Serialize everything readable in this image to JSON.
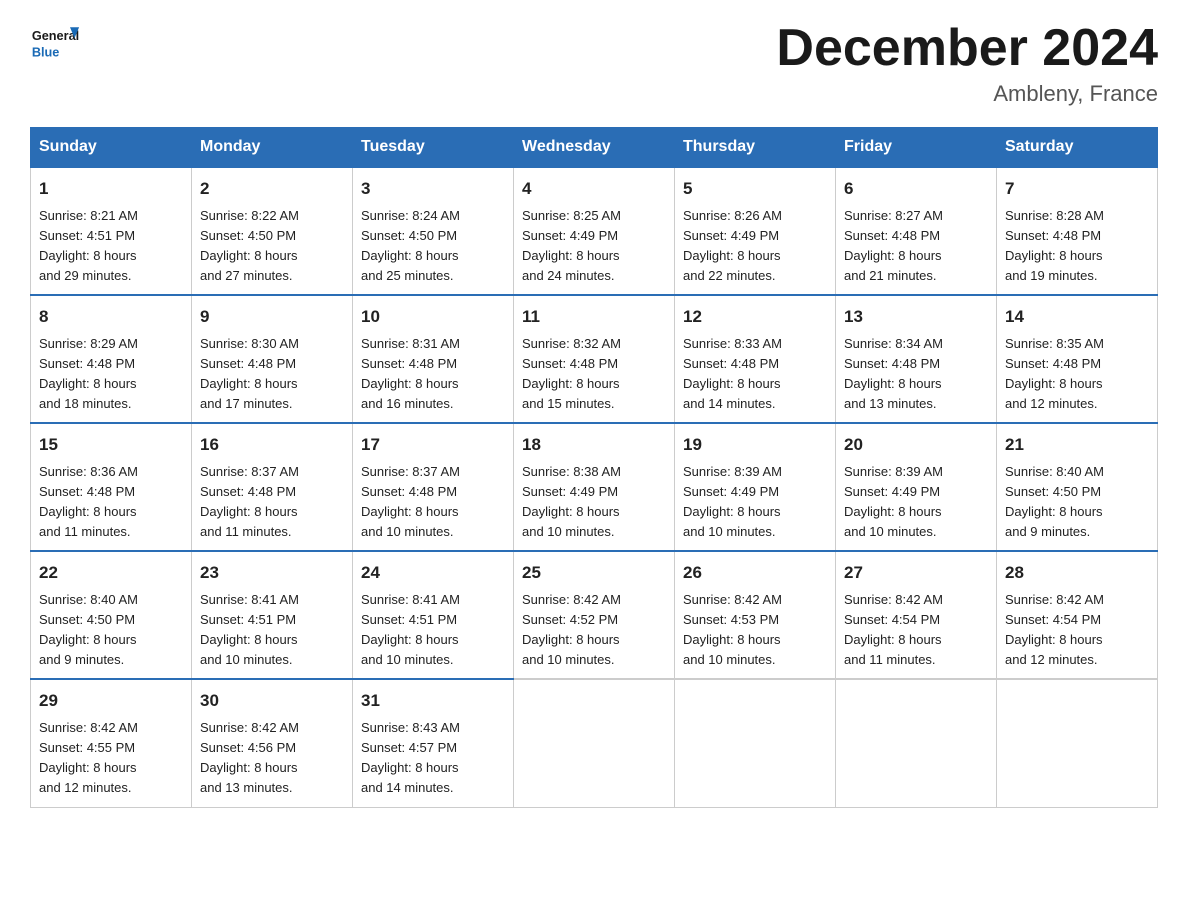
{
  "header": {
    "logo_general": "General",
    "logo_blue": "Blue",
    "month_title": "December 2024",
    "location": "Ambleny, France"
  },
  "days_of_week": [
    "Sunday",
    "Monday",
    "Tuesday",
    "Wednesday",
    "Thursday",
    "Friday",
    "Saturday"
  ],
  "weeks": [
    [
      {
        "day": "1",
        "sunrise": "8:21 AM",
        "sunset": "4:51 PM",
        "daylight": "8 hours and 29 minutes."
      },
      {
        "day": "2",
        "sunrise": "8:22 AM",
        "sunset": "4:50 PM",
        "daylight": "8 hours and 27 minutes."
      },
      {
        "day": "3",
        "sunrise": "8:24 AM",
        "sunset": "4:50 PM",
        "daylight": "8 hours and 25 minutes."
      },
      {
        "day": "4",
        "sunrise": "8:25 AM",
        "sunset": "4:49 PM",
        "daylight": "8 hours and 24 minutes."
      },
      {
        "day": "5",
        "sunrise": "8:26 AM",
        "sunset": "4:49 PM",
        "daylight": "8 hours and 22 minutes."
      },
      {
        "day": "6",
        "sunrise": "8:27 AM",
        "sunset": "4:48 PM",
        "daylight": "8 hours and 21 minutes."
      },
      {
        "day": "7",
        "sunrise": "8:28 AM",
        "sunset": "4:48 PM",
        "daylight": "8 hours and 19 minutes."
      }
    ],
    [
      {
        "day": "8",
        "sunrise": "8:29 AM",
        "sunset": "4:48 PM",
        "daylight": "8 hours and 18 minutes."
      },
      {
        "day": "9",
        "sunrise": "8:30 AM",
        "sunset": "4:48 PM",
        "daylight": "8 hours and 17 minutes."
      },
      {
        "day": "10",
        "sunrise": "8:31 AM",
        "sunset": "4:48 PM",
        "daylight": "8 hours and 16 minutes."
      },
      {
        "day": "11",
        "sunrise": "8:32 AM",
        "sunset": "4:48 PM",
        "daylight": "8 hours and 15 minutes."
      },
      {
        "day": "12",
        "sunrise": "8:33 AM",
        "sunset": "4:48 PM",
        "daylight": "8 hours and 14 minutes."
      },
      {
        "day": "13",
        "sunrise": "8:34 AM",
        "sunset": "4:48 PM",
        "daylight": "8 hours and 13 minutes."
      },
      {
        "day": "14",
        "sunrise": "8:35 AM",
        "sunset": "4:48 PM",
        "daylight": "8 hours and 12 minutes."
      }
    ],
    [
      {
        "day": "15",
        "sunrise": "8:36 AM",
        "sunset": "4:48 PM",
        "daylight": "8 hours and 11 minutes."
      },
      {
        "day": "16",
        "sunrise": "8:37 AM",
        "sunset": "4:48 PM",
        "daylight": "8 hours and 11 minutes."
      },
      {
        "day": "17",
        "sunrise": "8:37 AM",
        "sunset": "4:48 PM",
        "daylight": "8 hours and 10 minutes."
      },
      {
        "day": "18",
        "sunrise": "8:38 AM",
        "sunset": "4:49 PM",
        "daylight": "8 hours and 10 minutes."
      },
      {
        "day": "19",
        "sunrise": "8:39 AM",
        "sunset": "4:49 PM",
        "daylight": "8 hours and 10 minutes."
      },
      {
        "day": "20",
        "sunrise": "8:39 AM",
        "sunset": "4:49 PM",
        "daylight": "8 hours and 10 minutes."
      },
      {
        "day": "21",
        "sunrise": "8:40 AM",
        "sunset": "4:50 PM",
        "daylight": "8 hours and 9 minutes."
      }
    ],
    [
      {
        "day": "22",
        "sunrise": "8:40 AM",
        "sunset": "4:50 PM",
        "daylight": "8 hours and 9 minutes."
      },
      {
        "day": "23",
        "sunrise": "8:41 AM",
        "sunset": "4:51 PM",
        "daylight": "8 hours and 10 minutes."
      },
      {
        "day": "24",
        "sunrise": "8:41 AM",
        "sunset": "4:51 PM",
        "daylight": "8 hours and 10 minutes."
      },
      {
        "day": "25",
        "sunrise": "8:42 AM",
        "sunset": "4:52 PM",
        "daylight": "8 hours and 10 minutes."
      },
      {
        "day": "26",
        "sunrise": "8:42 AM",
        "sunset": "4:53 PM",
        "daylight": "8 hours and 10 minutes."
      },
      {
        "day": "27",
        "sunrise": "8:42 AM",
        "sunset": "4:54 PM",
        "daylight": "8 hours and 11 minutes."
      },
      {
        "day": "28",
        "sunrise": "8:42 AM",
        "sunset": "4:54 PM",
        "daylight": "8 hours and 12 minutes."
      }
    ],
    [
      {
        "day": "29",
        "sunrise": "8:42 AM",
        "sunset": "4:55 PM",
        "daylight": "8 hours and 12 minutes."
      },
      {
        "day": "30",
        "sunrise": "8:42 AM",
        "sunset": "4:56 PM",
        "daylight": "8 hours and 13 minutes."
      },
      {
        "day": "31",
        "sunrise": "8:43 AM",
        "sunset": "4:57 PM",
        "daylight": "8 hours and 14 minutes."
      },
      null,
      null,
      null,
      null
    ]
  ],
  "labels": {
    "sunrise": "Sunrise:",
    "sunset": "Sunset:",
    "daylight": "Daylight:"
  }
}
